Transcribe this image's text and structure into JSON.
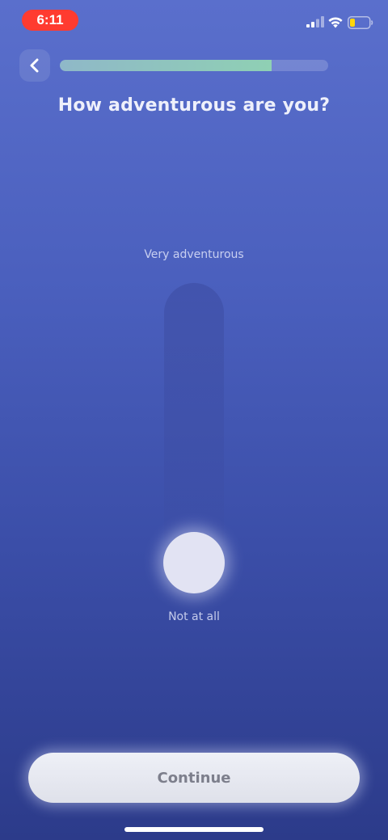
{
  "status_bar": {
    "time": "6:11",
    "signal_icon": "cellular-signal-icon",
    "wifi_icon": "wifi-icon",
    "battery_icon": "battery-low-icon",
    "time_pill_color": "#ff3b30",
    "battery_level_color": "#ffd60a"
  },
  "header": {
    "back_icon": "chevron-left-icon",
    "progress_fraction": 0.79
  },
  "question": {
    "title": "How adventurous are you?"
  },
  "slider": {
    "top_label": "Very adventurous",
    "bottom_label": "Not at all",
    "value_fraction": 0.0
  },
  "footer": {
    "continue_label": "Continue"
  },
  "colors": {
    "background_top": "#5a6fcc",
    "background_bottom": "#2c3b8a",
    "progress_fill": "#8fd0b4"
  }
}
